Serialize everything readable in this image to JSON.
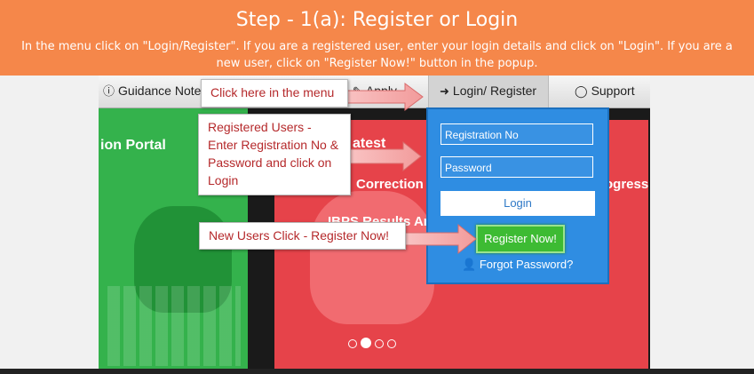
{
  "banner": {
    "title": "Step - 1(a): Register or Login",
    "description": "In the menu click on \"Login/Register\". If you are a registered user, enter your login details and click on \"Login\". If you are a new user, click on \"Register Now!\" button in the popup."
  },
  "nav": {
    "guidance": "Guidance Notes",
    "apply": "Apply",
    "login_register": "Login/ Register",
    "support": "Support"
  },
  "slides": {
    "portal_text": "ion Portal",
    "latest_text": "atest",
    "correction_text": "Correction",
    "progress_text": "ogress",
    "results_text": "IBPS Results An"
  },
  "login_panel": {
    "registration_placeholder": "Registration No",
    "password_placeholder": "Password",
    "login_label": "Login",
    "register_label": "Register Now!",
    "forgot_label": "Forgot Password?"
  },
  "callouts": {
    "menu": "Click here in the menu",
    "registered": "Registered Users - Enter Registration No & Password and click on Login",
    "new_users": "New Users Click - Register Now!"
  },
  "carousel": {
    "active_index": 1,
    "count": 4
  },
  "colors": {
    "banner": "#f5874a",
    "panel": "#2f8de2",
    "register_button": "#3dbb33",
    "callout_text": "#b5292b",
    "slide_green": "#34b24c",
    "slide_red": "#e6434a"
  }
}
